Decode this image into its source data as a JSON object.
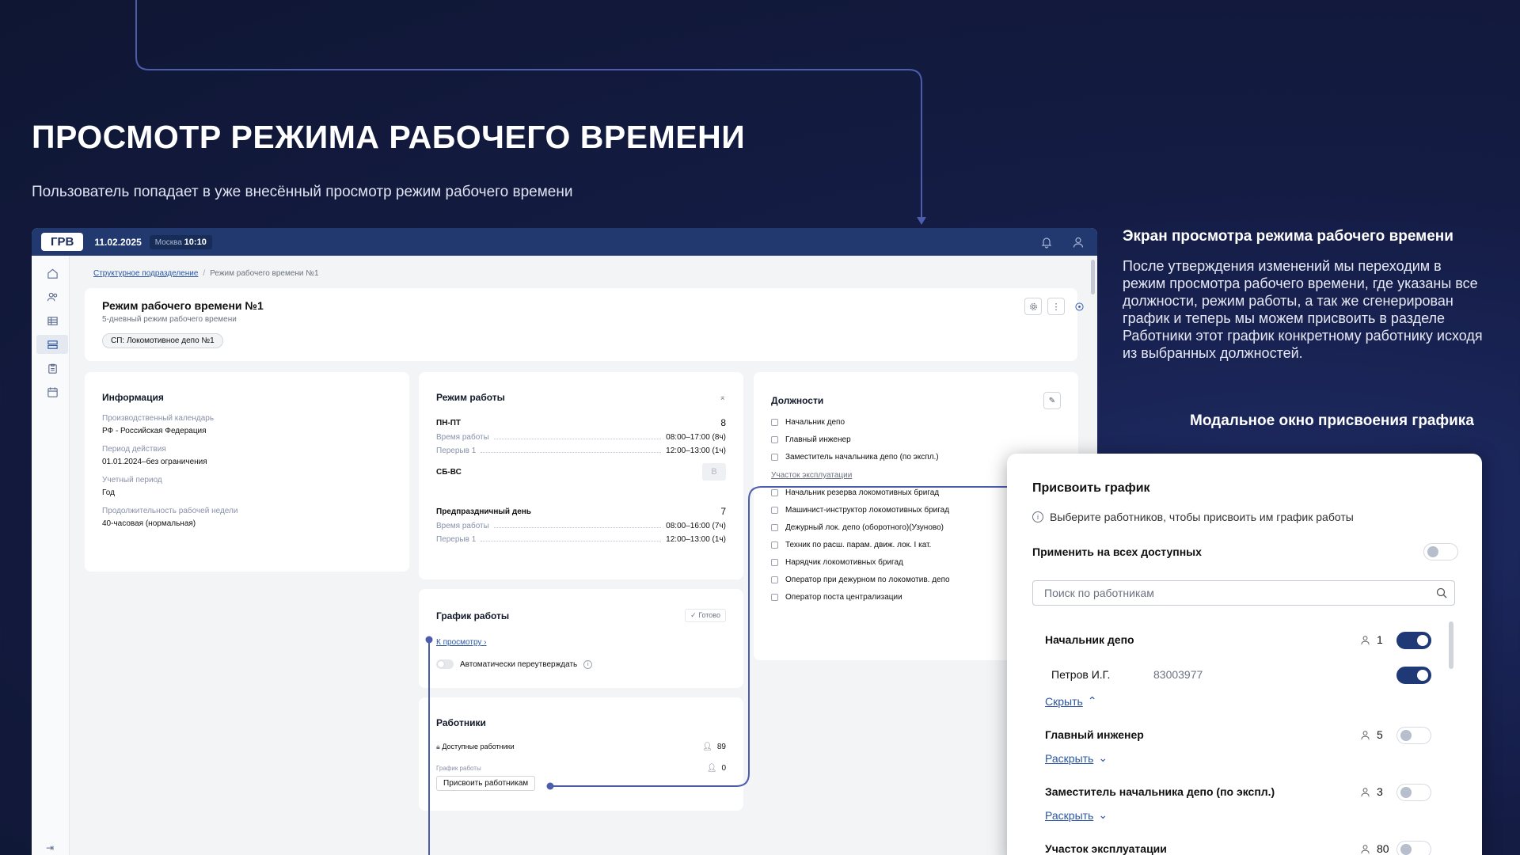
{
  "slide": {
    "title": "ПРОСМОТР РЕЖИМА РАБОЧЕГО ВРЕМЕНИ",
    "subtitle": "Пользователь попадает в уже внесённый просмотр режим рабочего времени",
    "right_heading": "Экран просмотра режима рабочего времени",
    "right_description": "После утверждения изменений мы переходим в режим просмотра рабочего времени, где указаны все должности, режим работы, а так же сгенерирован график и теперь мы можем присвоить в разделе Работники этот график конкретному работнику исходя из выбранных должностей.",
    "modal_caption": "Модальное окно присвоения графика"
  },
  "topbar": {
    "logo": "ГРВ",
    "date": "11.02.2025",
    "tz_label": "Москва",
    "time": "10:10"
  },
  "breadcrumb": {
    "parent": "Структурное подразделение",
    "separator": "/",
    "current": "Режим рабочего времени №1"
  },
  "header": {
    "title": "Режим рабочего времени №1",
    "subtitle": "5-дневный режим рабочего времени",
    "chip": "СП: Локомотивное депо №1"
  },
  "info": {
    "title": "Информация",
    "fields": [
      {
        "label": "Производственный календарь",
        "value": "РФ - Российская Федерация"
      },
      {
        "label": "Период действия",
        "value": "01.01.2024–без ограничения"
      },
      {
        "label": "Учетный период",
        "value": "Год"
      },
      {
        "label": "Продолжительность рабочей недели",
        "value": "40-часовая (нормальная)"
      }
    ]
  },
  "mode": {
    "title": "Режим работы",
    "weekday_label": "ПН-ПТ",
    "weekday_num": "8",
    "time_label": "Время работы",
    "weekday_time": "08:00–17:00 (8ч)",
    "break_label": "Перерыв 1",
    "weekday_break": "12:00–13:00 (1ч)",
    "weekend_label": "СБ-ВС",
    "weekend_badge": "В",
    "preholiday_label": "Предпраздничный день",
    "preholiday_num": "7",
    "preholiday_time": "08:00–16:00 (7ч)",
    "preholiday_break": "12:00–13:00 (1ч)"
  },
  "schedule": {
    "title": "График работы",
    "status": "✓ Готово",
    "view_link": "К просмотру",
    "auto_label": "Автоматически переутверждать"
  },
  "workers": {
    "title": "Работники",
    "available_label": "Доступные работники",
    "available_count": "89",
    "schedule_label": "График работы",
    "schedule_count": "0",
    "assign_button": "Присвоить работникам"
  },
  "positions": {
    "title": "Должности",
    "items_top": [
      "Начальник депо",
      "Главный инженер",
      "Заместитель начальника депо (по экспл.)"
    ],
    "section": "Участок эксплуатации",
    "items_section": [
      "Начальник резерва локомотивных бригад",
      "Машинист-инструктор локомотивных бригад",
      "Дежурный лок. депо (оборотного)(Узуново)",
      "Техник по расш. парам. движ. лок. I кат.",
      "Нарядчик локомотивных бригад",
      "Оператор при дежурном по локомотив. депо",
      "Оператор поста централизации"
    ]
  },
  "modal": {
    "title": "Присвоить график",
    "hint": "Выберите работников, чтобы присвоить им график работы",
    "apply_all": "Применить на всех доступных",
    "search_placeholder": "Поиск по работникам",
    "groups": [
      {
        "name": "Начальник депо",
        "count": "1",
        "enabled": true,
        "link": "Скрыть"
      },
      {
        "name": "Главный инженер",
        "count": "5",
        "enabled": false,
        "link": "Раскрыть"
      },
      {
        "name": "Заместитель начальника депо (по экспл.)",
        "count": "3",
        "enabled": false,
        "link": "Раскрыть"
      },
      {
        "name": "Участок эксплуатации",
        "count": "80",
        "enabled": false
      }
    ],
    "person": {
      "name": "Петров И.Г.",
      "id": "83003977",
      "enabled": true
    }
  },
  "colors": {
    "accent": "#21396f",
    "toggle_on": "#1f3876",
    "connector": "#4c5dab",
    "link": "#2a56a4"
  }
}
